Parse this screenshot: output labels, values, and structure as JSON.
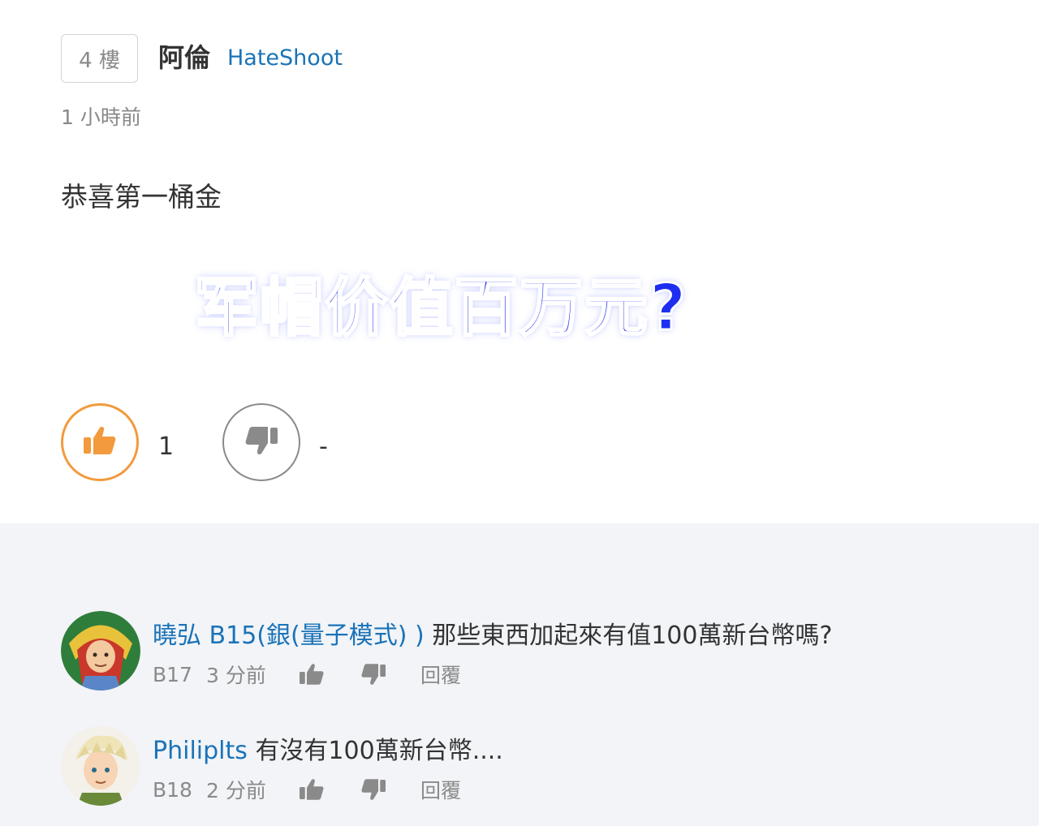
{
  "post": {
    "floor": "4 樓",
    "author_name": "阿倫",
    "author_id": "HateShoot",
    "time": "1 小時前",
    "text": "恭喜第一桶金",
    "banner": "军帽价值百万元?",
    "upvotes": "1",
    "downvotes": "-",
    "colors": {
      "accent": "#f29a3d",
      "link": "#1a73b8",
      "banner": "#1e2ef0"
    }
  },
  "replies": [
    {
      "user": "曉弘 B15(銀(量子模式) )",
      "text": "那些東西加起來有值100萬新台幣嗎?",
      "floor": "B17",
      "time": "3 分前",
      "reply_label": "回覆",
      "avatar": "knight-avatar"
    },
    {
      "user": "Philiplts",
      "text": "有沒有100萬新台幣....",
      "floor": "B18",
      "time": "2 分前",
      "reply_label": "回覆",
      "avatar": "blond-hero-avatar"
    }
  ]
}
